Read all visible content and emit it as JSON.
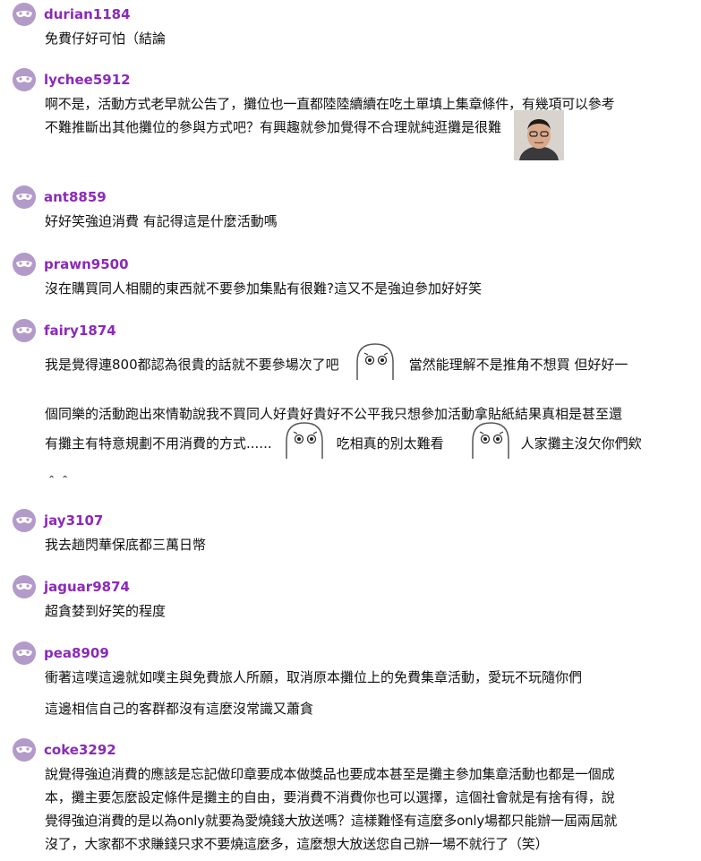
{
  "comments": [
    {
      "user": "durian1184",
      "lines": [
        "免費仔好可怕（結論"
      ]
    },
    {
      "user": "lychee5912",
      "lines": [
        "啊不是，活動方式老早就公告了，攤位也一直都陸陸續續在吃土單填上集章條件，有幾項可以參考",
        "不難推斷出其他攤位的參與方式吧？有興趣就參加覺得不合理就純逛攤是很難"
      ]
    },
    {
      "user": "ant8859",
      "lines": [
        "好好笑強迫消費 有記得這是什麼活動嗎"
      ]
    },
    {
      "user": "prawn9500",
      "lines": [
        "沒在購買同人相關的東西就不要參加集點有很難?這又不是強迫參加好好笑"
      ]
    },
    {
      "user": "fairy1874",
      "lines": [
        "我是覺得連800都認為很貴的話就不要參場次了吧",
        "當然能理解不是推角不想買 但好好一",
        "個同樂的活動跑出來情勒說我不買同人好貴好貴好不公平我只想參加活動拿貼紙結果真相是甚至還",
        "有攤主有特意規劃不用消費的方式......",
        "吃相真的別太難看",
        "人家攤主沒欠你們欸",
        "＾＾"
      ]
    },
    {
      "user": "jay3107",
      "lines": [
        "我去趟閃華保底都三萬日幣"
      ]
    },
    {
      "user": "jaguar9874",
      "lines": [
        "超貪婪到好笑的程度"
      ]
    },
    {
      "user": "pea8909",
      "lines": [
        "衝著這噗這邊就如噗主與免費旅人所願，取消原本攤位上的免費集章活動，愛玩不玩隨你們",
        "這邊相信自己的客群都沒有這麼沒常識又蕭貪"
      ]
    },
    {
      "user": "coke3292",
      "lines": [
        "說覺得強迫消費的應該是忘記做印章要成本做獎品也要成本甚至是攤主參加集章活動也都是一個成",
        "本，攤主要怎麼設定條件是攤主的自由，要消費不消費你也可以選擇，這個社會就是有捨有得，說",
        "覺得強迫消費的是以為only就要為愛燒錢大放送嗎？這樣難怪有這麼多only場都只能辦一屆兩屆就",
        "沒了，大家都不求賺錢只求不要燒這麼多，這麼想大放送您自己辦一場不就行了（笑）"
      ]
    }
  ],
  "colors": {
    "username": "#8b2ab8",
    "avatar": "#b29ac9",
    "text": "#111111"
  },
  "icons": {
    "avatar": "mask-avatar-icon",
    "sticker": "ghost-sticker-icon",
    "photo": "user-photo-icon"
  }
}
